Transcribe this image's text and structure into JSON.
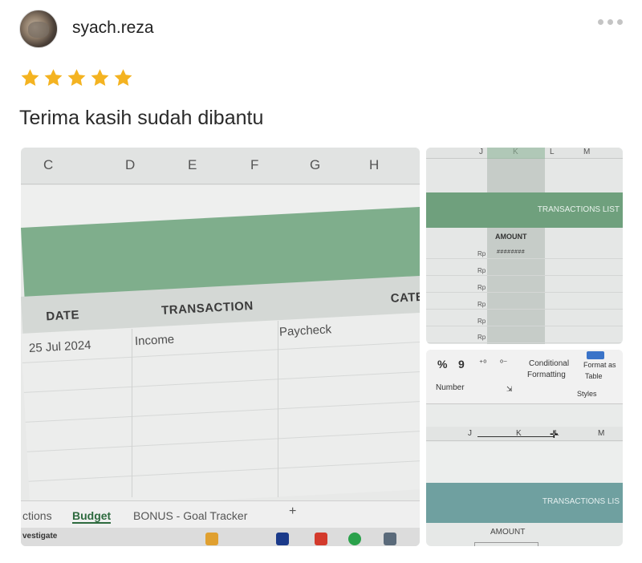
{
  "post": {
    "username": "syach.reza",
    "rating": 5,
    "review_text": "Terima kasih sudah dibantu"
  },
  "colors": {
    "star": "#f4b321",
    "sheet_green": "#7fae8c"
  },
  "icons": [
    "avatar",
    "more-icon",
    "star-icon"
  ],
  "photo_main": {
    "columns": [
      "C",
      "D",
      "E",
      "F",
      "G",
      "H"
    ],
    "table_headers": [
      "DATE",
      "TRANSACTION",
      "CATE"
    ],
    "row1": {
      "date": "25 Jul 2024",
      "type": "Income",
      "desc": "Paycheck"
    },
    "sheet_tabs": [
      "ctions",
      "Budget",
      "BONUS - Goal Tracker",
      "+"
    ],
    "status_label": "vestigate"
  },
  "photo_top_right": {
    "columns": [
      "J",
      "K",
      "L",
      "M"
    ],
    "banner": "TRANSACTIONS LIST",
    "amount_header": "AMOUNT",
    "currency": "Rp",
    "hash_value": "########"
  },
  "photo_bottom_right": {
    "ribbon": {
      "percent": "%",
      "comma": "9",
      "number_label": "Number",
      "conditional": "Conditional",
      "formatting": "Formatting",
      "format_as": "Format as",
      "table": "Table",
      "styles": "Styles"
    },
    "columns": [
      "J",
      "K",
      "L",
      "M"
    ],
    "banner": "TRANSACTIONS LIS",
    "amount_header": "AMOUNT"
  }
}
